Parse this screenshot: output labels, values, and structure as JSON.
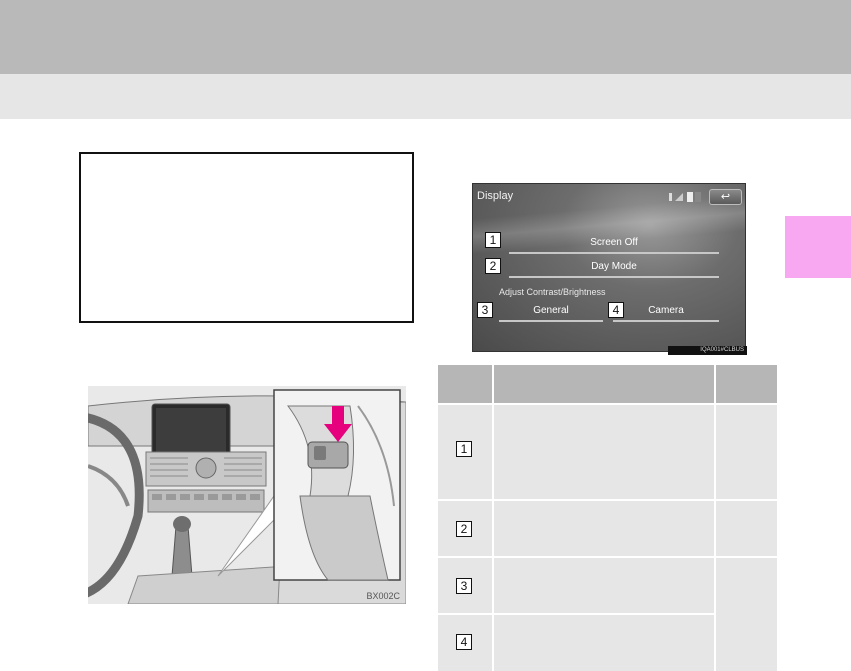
{
  "display_screen": {
    "title": "Display",
    "back_glyph": "↩",
    "items": [
      {
        "number": "1",
        "label": "Screen Off"
      },
      {
        "number": "2",
        "label": "Day Mode"
      },
      {
        "number": "3",
        "label": "General"
      },
      {
        "number": "4",
        "label": "Camera"
      }
    ],
    "section_label": "Adjust Contrast/Brightness",
    "image_code": "IQA001#CLBUS"
  },
  "illustration": {
    "image_code": "BX002C",
    "arrow_color": "#e6007e"
  },
  "table": {
    "rows": [
      {
        "number": "1"
      },
      {
        "number": "2"
      },
      {
        "number": "3"
      },
      {
        "number": "4"
      }
    ]
  },
  "colors": {
    "header": "#b9b9b9",
    "subheader": "#e6e6e6",
    "chapter_tab": "#f8a8f0",
    "table_header": "#b6b6b6",
    "table_body": "#e6e6e6"
  }
}
